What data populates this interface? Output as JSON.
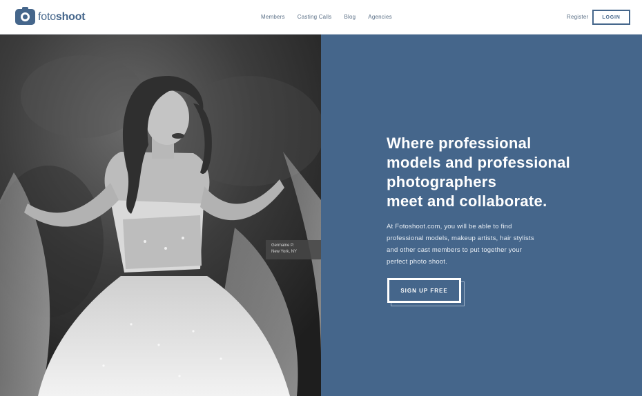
{
  "header": {
    "logo_light": "foto",
    "logo_bold": "shoot",
    "nav": [
      "Members",
      "Casting Calls",
      "Blog",
      "Agencies"
    ],
    "register": "Register",
    "login": "LOGIN"
  },
  "photo": {
    "caption_name": "Germaine P.",
    "caption_location": "New York, NY"
  },
  "hero": {
    "headline": [
      "Where professional",
      "models and professional",
      "photographers",
      "meet and collaborate."
    ],
    "body": [
      "At Fotoshoot.com, you will be able to find",
      "professional models, makeup artists, hair stylists",
      "and other cast members to put together your",
      "perfect photo shoot."
    ],
    "cta": "SIGN UP FREE"
  },
  "colors": {
    "brand": "#45668b",
    "header_bg": "#ffffff"
  }
}
